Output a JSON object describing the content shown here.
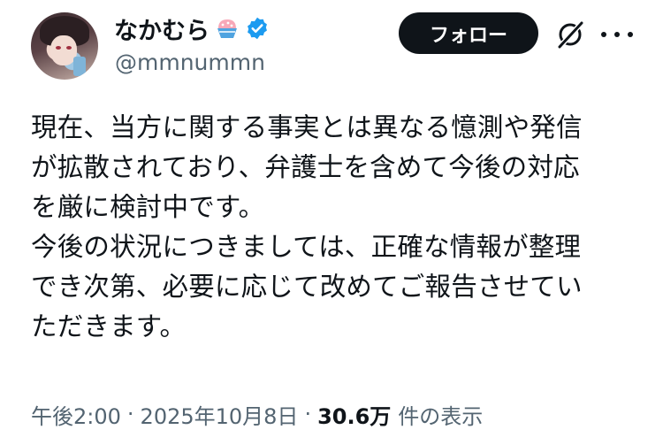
{
  "user": {
    "display_name": "なかむら",
    "handle": "@mmnummn",
    "name_emoji_icon": "shaved-ice-emoji",
    "verified_icon": "verified-badge-icon"
  },
  "actions": {
    "follow_label": "フォロー",
    "grok_icon": "grok-icon",
    "more_icon": "more-dots-icon"
  },
  "post": {
    "lines": [
      "現在、当方に関する事実とは異なる憶測や発信",
      "が拡散されており、弁護士を含めて今後の対応",
      "を厳に検討中です。",
      "今後の状況につきましては、正確な情報が整理",
      "でき次第、必要に応じて改めてご報告させてい",
      "ただきます。"
    ]
  },
  "meta": {
    "time": "午後2:00",
    "separator": "·",
    "date": "2025年10月8日",
    "views_count": "30.6万",
    "views_label": "件の表示"
  },
  "colors": {
    "text": "#0f1419",
    "secondary": "#536471",
    "verified": "#1d9bf0",
    "button_bg": "#0f1419"
  }
}
